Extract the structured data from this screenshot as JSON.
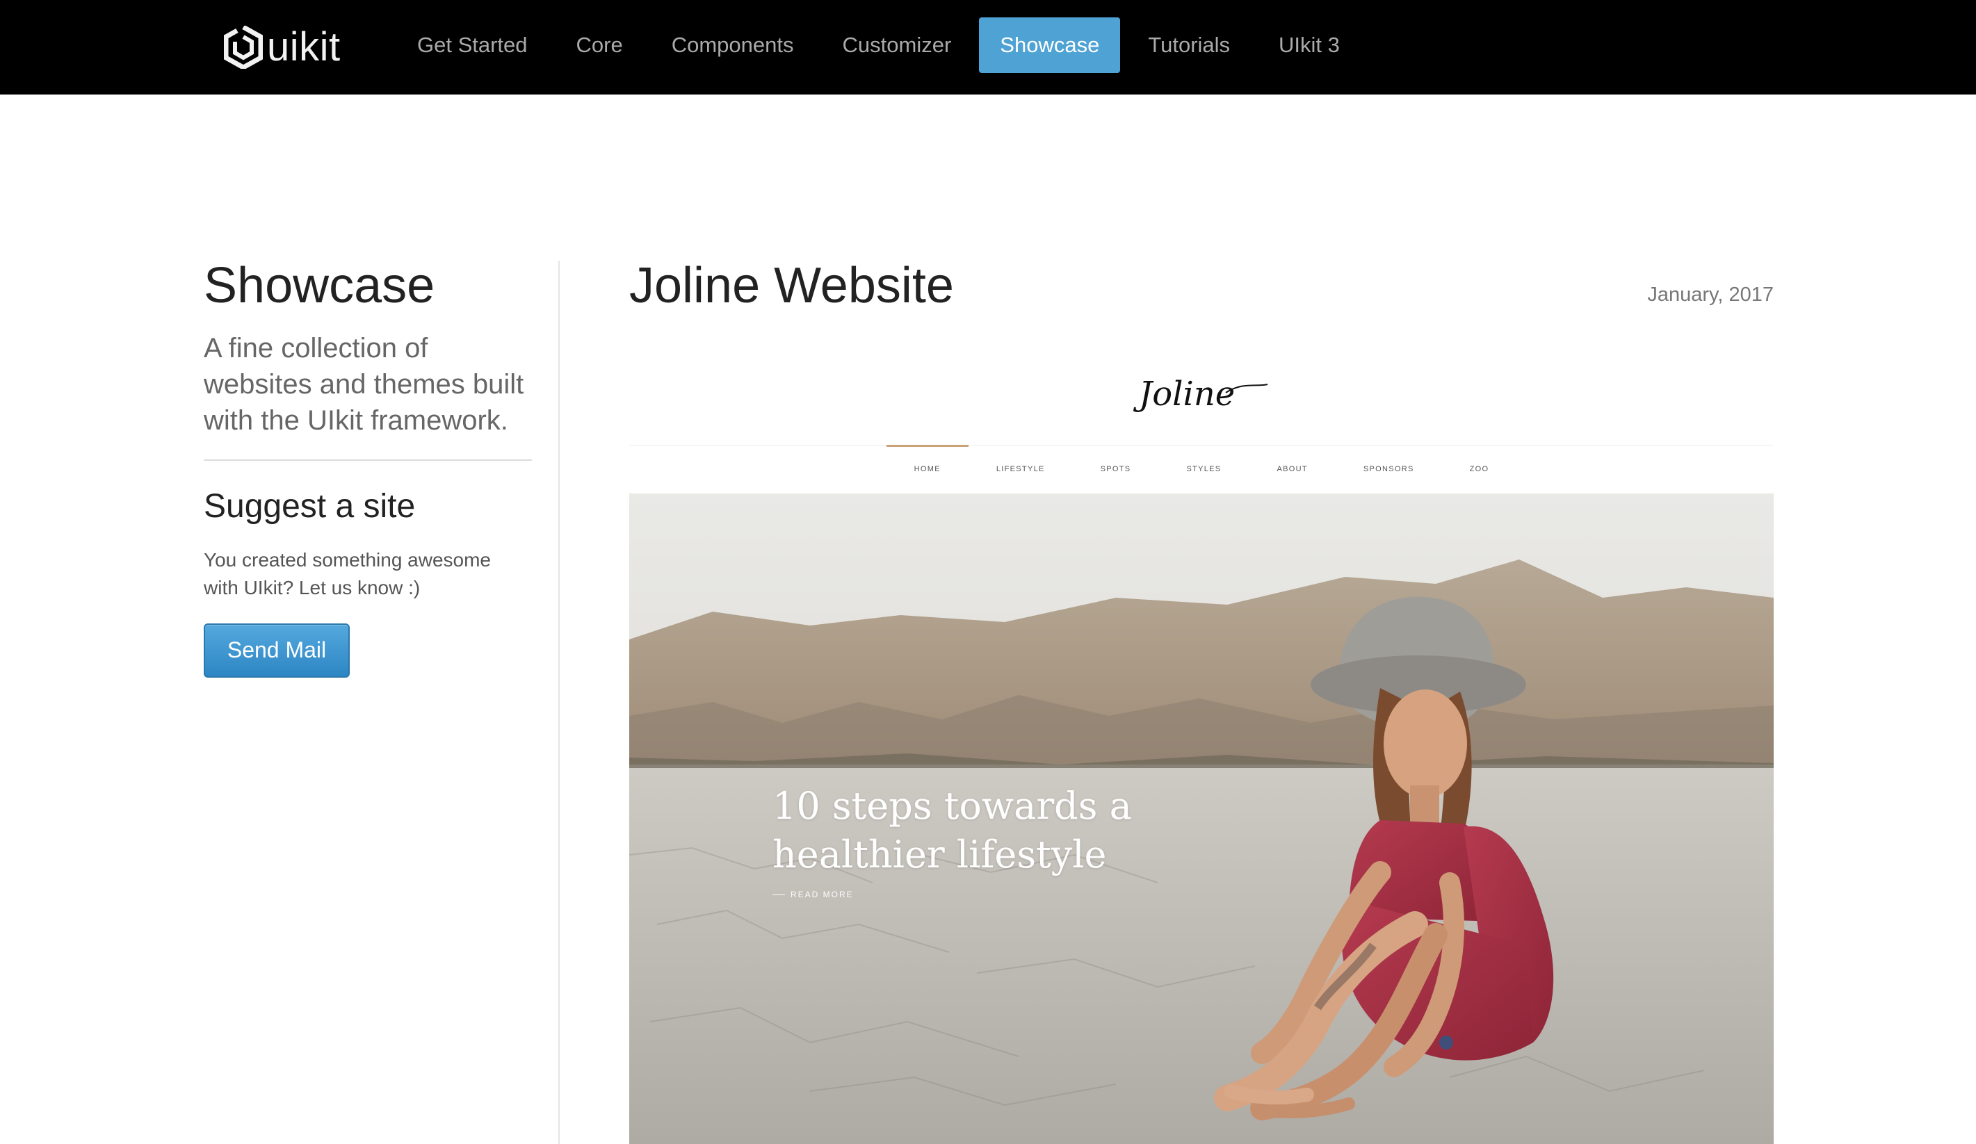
{
  "navbar": {
    "brand": "uikit",
    "items": [
      {
        "label": "Get Started",
        "active": false
      },
      {
        "label": "Core",
        "active": false
      },
      {
        "label": "Components",
        "active": false
      },
      {
        "label": "Customizer",
        "active": false
      },
      {
        "label": "Showcase",
        "active": true
      },
      {
        "label": "Tutorials",
        "active": false
      },
      {
        "label": "UIkit 3",
        "active": false
      }
    ]
  },
  "sidebar": {
    "title": "Showcase",
    "lead": "A fine collection of websites and themes built with the UIkit framework.",
    "suggest_title": "Suggest a site",
    "suggest_text": "You created something awesome with UIkit? Let us know :)",
    "send_button": "Send Mail"
  },
  "main": {
    "site_title": "Joline Website",
    "date": "January, 2017",
    "preview": {
      "logo_text": "Joline",
      "nav": [
        "HOME",
        "LIFESTYLE",
        "SPOTS",
        "STYLES",
        "ABOUT",
        "SPONSORS",
        "ZOO"
      ],
      "active_nav": "HOME",
      "headline": "10 steps towards a healthier lifestyle",
      "read_more": "READ MORE"
    }
  },
  "colors": {
    "navbar_bg": "#000000",
    "nav_active_bg": "#4fa2d4",
    "button_blue": "#2d86c4",
    "divider": "#dddddd"
  },
  "icons": {
    "brand_logo": "uikit-logo-icon"
  }
}
